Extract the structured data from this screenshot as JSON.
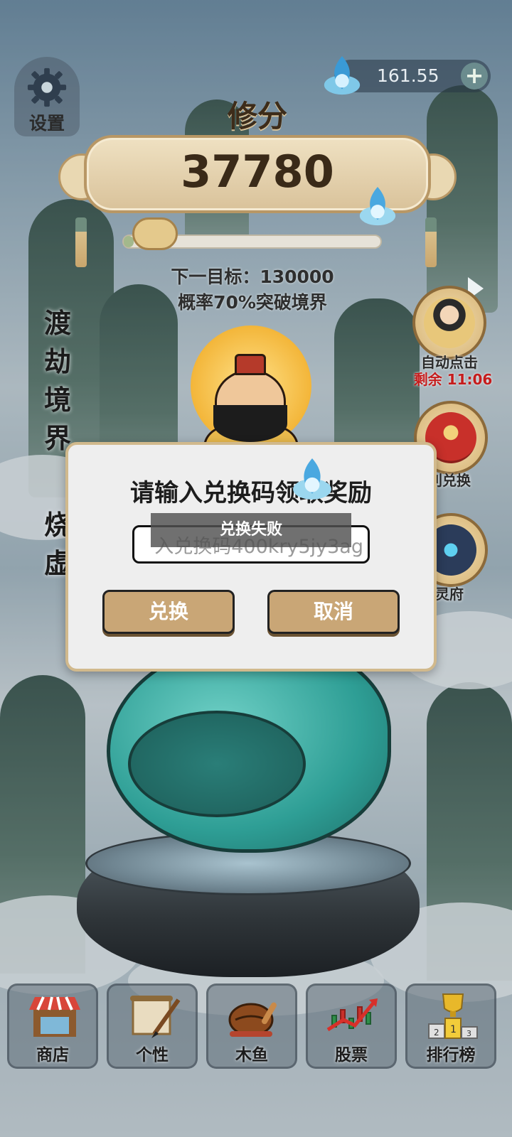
{
  "settings": {
    "label": "设置",
    "icon": "gear-icon"
  },
  "currency": {
    "value": "161.55",
    "plus_label": "+",
    "icon": "spirit-flame-icon"
  },
  "score": {
    "title": "修分",
    "value": "37780",
    "progress": 0.04
  },
  "target": {
    "next_label": "下一目标：130000",
    "chance_label": "概率70%突破境界"
  },
  "side_labels": {
    "realm": [
      "渡",
      "劫",
      "境",
      "界"
    ],
    "burn": [
      "烧",
      "虚"
    ]
  },
  "features": {
    "auto_click": {
      "label": "自动点击",
      "timer": "剩余 11:06"
    },
    "redeem": {
      "label": "利兑换"
    },
    "spirit_house": {
      "label": "灵府"
    }
  },
  "dialog": {
    "title": "请输入兑换码领取奖励",
    "input_value": "入兑换码400kry5jy3ag",
    "toast": "兑换失败",
    "confirm_label": "兑换",
    "cancel_label": "取消"
  },
  "nav": [
    {
      "label": "商店",
      "icon": "shop-icon"
    },
    {
      "label": "个性",
      "icon": "brush-scroll-icon"
    },
    {
      "label": "木鱼",
      "icon": "wooden-fish-icon"
    },
    {
      "label": "股票",
      "icon": "stock-chart-icon"
    },
    {
      "label": "排行榜",
      "icon": "trophy-podium-icon"
    }
  ],
  "colors": {
    "accent_gold": "#c9a676",
    "jade": "#2e9e95",
    "timer_red": "#c51c1c"
  }
}
